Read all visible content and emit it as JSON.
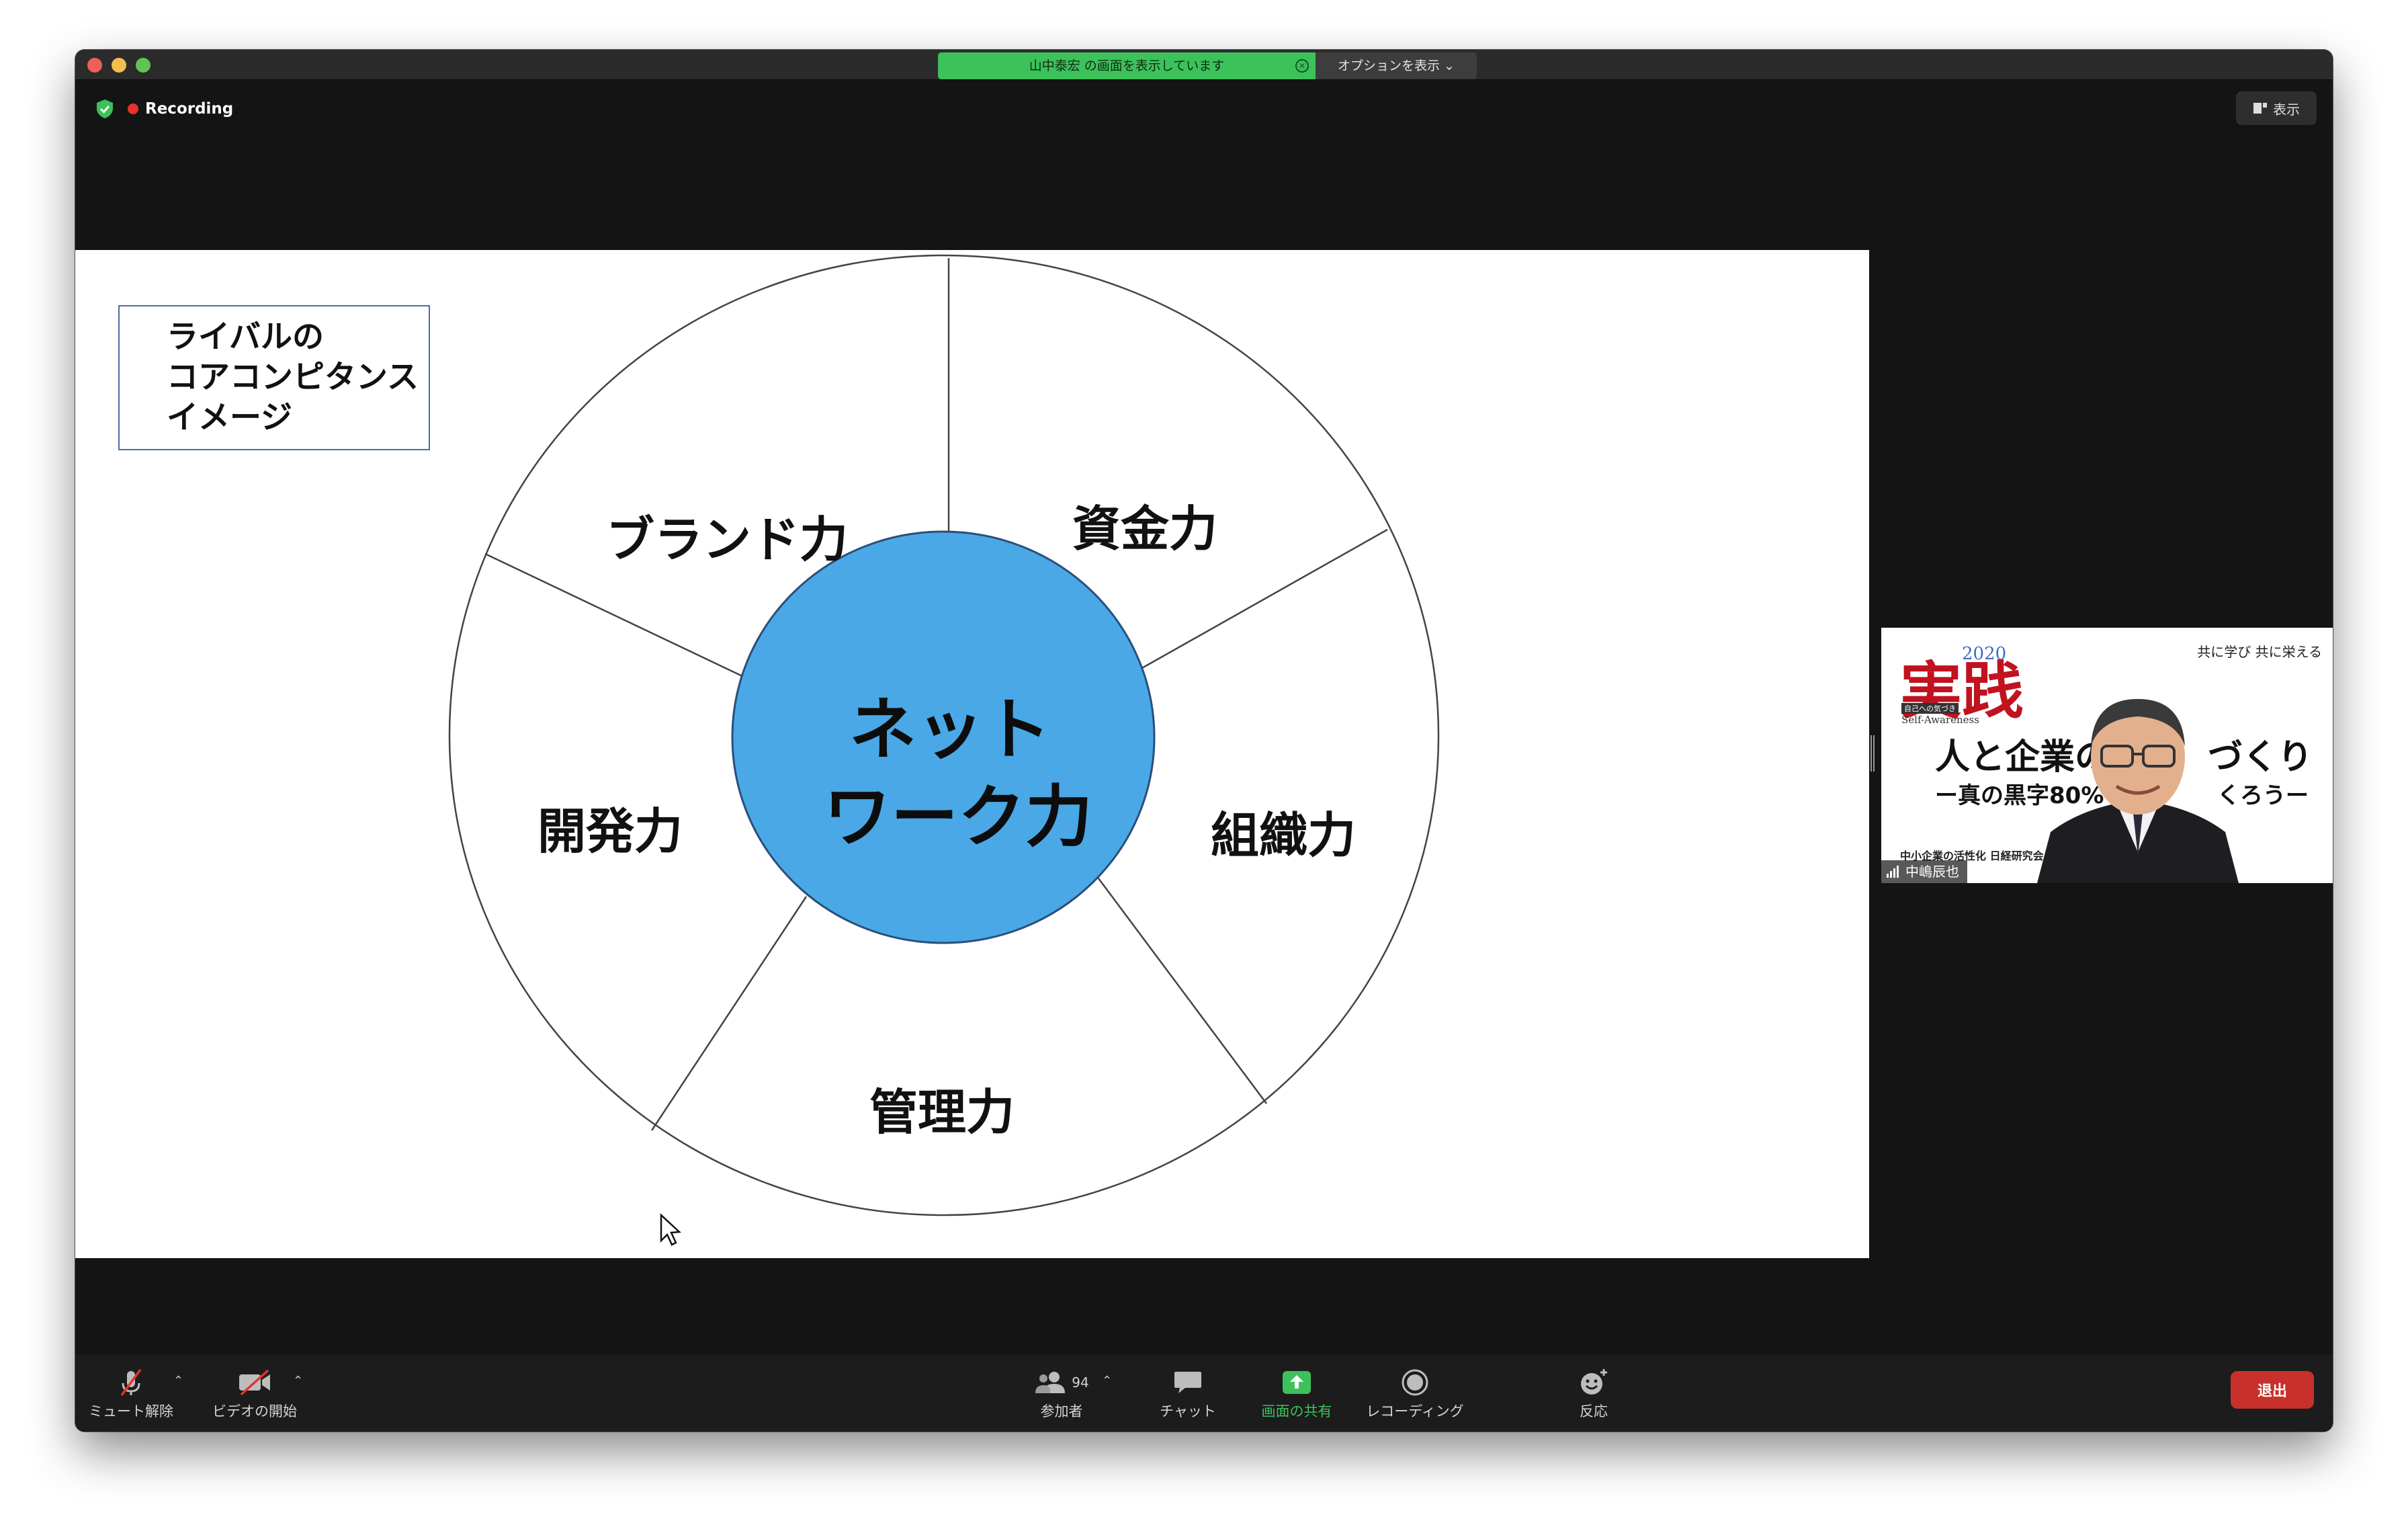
{
  "titlebar": {
    "share_banner": "山中泰宏 の画面を表示しています",
    "options_label": "オプションを表示 ⌄"
  },
  "recording": {
    "label": "Recording"
  },
  "view_button": {
    "label": "表示"
  },
  "slide": {
    "label_box": [
      "ライバルの",
      "コアコンピタンス",
      "イメージ"
    ],
    "center": [
      "ネット",
      "ワーク力"
    ],
    "segments": [
      "ブランド力",
      "資金力",
      "組織力",
      "管理力",
      "開発力"
    ]
  },
  "thumbnail": {
    "participant_name": "中嶋辰也",
    "logo": "実践",
    "year": "2020",
    "motto": "共に学び 共に栄える",
    "subtitle_small": "自己への気づき",
    "subtitle_en": "Self-Awareness",
    "title_line1": "人と企業の",
    "title_line1_end": "づくり",
    "title_line2": "ー真の黒字80%",
    "title_line2_end": "くろうー",
    "org": "中小企業の活性化 日経研究会"
  },
  "toolbar": {
    "mute": "ミュート解除",
    "video": "ビデオの開始",
    "participants": "参加者",
    "participants_count": "94",
    "chat": "チャット",
    "share": "画面の共有",
    "record": "レコーディング",
    "reactions": "反応",
    "leave": "退出"
  },
  "colors": {
    "share_green": "#3cc15b",
    "leave_red": "#c8302b",
    "center_circle": "#4aa8e6",
    "recording_dot": "#e5322d"
  }
}
